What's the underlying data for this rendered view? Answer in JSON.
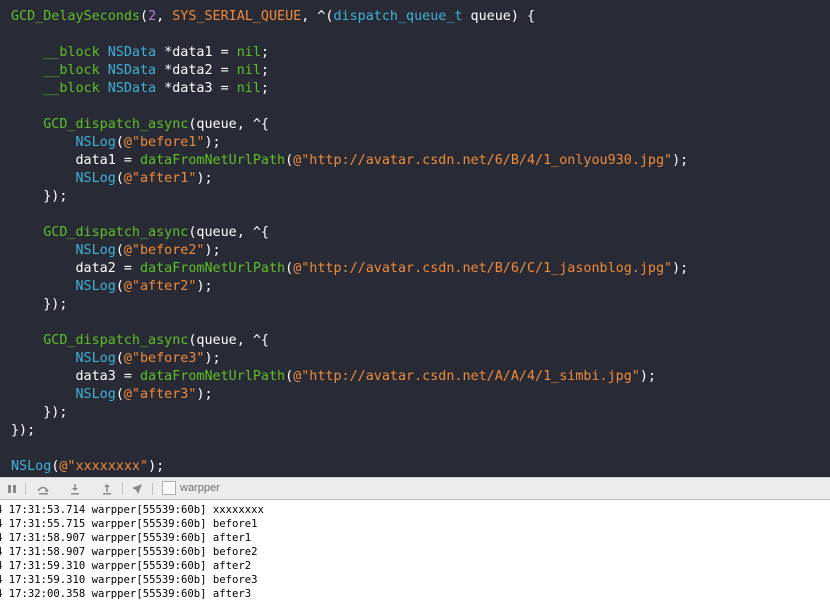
{
  "editor": {
    "lines": [
      [
        {
          "t": "GCD_DelaySeconds",
          "c": "green"
        },
        {
          "t": "(",
          "c": "white"
        },
        {
          "t": "2",
          "c": "purple"
        },
        {
          "t": ", ",
          "c": "white"
        },
        {
          "t": "SYS_SERIAL_QUEUE",
          "c": "orange"
        },
        {
          "t": ", ^(",
          "c": "white"
        },
        {
          "t": "dispatch_queue_t",
          "c": "blue"
        },
        {
          "t": " queue) {",
          "c": "white"
        }
      ],
      [],
      [
        {
          "t": "    ",
          "c": "white"
        },
        {
          "t": "__block",
          "c": "green"
        },
        {
          "t": " ",
          "c": "white"
        },
        {
          "t": "NSData",
          "c": "blue"
        },
        {
          "t": " *data1 = ",
          "c": "white"
        },
        {
          "t": "nil",
          "c": "green"
        },
        {
          "t": ";",
          "c": "white"
        }
      ],
      [
        {
          "t": "    ",
          "c": "white"
        },
        {
          "t": "__block",
          "c": "green"
        },
        {
          "t": " ",
          "c": "white"
        },
        {
          "t": "NSData",
          "c": "blue"
        },
        {
          "t": " *data2 = ",
          "c": "white"
        },
        {
          "t": "nil",
          "c": "green"
        },
        {
          "t": ";",
          "c": "white"
        }
      ],
      [
        {
          "t": "    ",
          "c": "white"
        },
        {
          "t": "__block",
          "c": "green"
        },
        {
          "t": " ",
          "c": "white"
        },
        {
          "t": "NSData",
          "c": "blue"
        },
        {
          "t": " *data3 = ",
          "c": "white"
        },
        {
          "t": "nil",
          "c": "green"
        },
        {
          "t": ";",
          "c": "white"
        }
      ],
      [],
      [
        {
          "t": "    ",
          "c": "white"
        },
        {
          "t": "GCD_dispatch_async",
          "c": "green"
        },
        {
          "t": "(queue, ^{",
          "c": "white"
        }
      ],
      [
        {
          "t": "        ",
          "c": "white"
        },
        {
          "t": "NSLog",
          "c": "blue"
        },
        {
          "t": "(",
          "c": "white"
        },
        {
          "t": "@\"before1\"",
          "c": "orange"
        },
        {
          "t": ");",
          "c": "white"
        }
      ],
      [
        {
          "t": "        data1 = ",
          "c": "white"
        },
        {
          "t": "dataFromNetUrlPath",
          "c": "green"
        },
        {
          "t": "(",
          "c": "white"
        },
        {
          "t": "@\"http://avatar.csdn.net/6/B/4/1_onlyou930.jpg\"",
          "c": "orange"
        },
        {
          "t": ");",
          "c": "white"
        }
      ],
      [
        {
          "t": "        ",
          "c": "white"
        },
        {
          "t": "NSLog",
          "c": "blue"
        },
        {
          "t": "(",
          "c": "white"
        },
        {
          "t": "@\"after1\"",
          "c": "orange"
        },
        {
          "t": ");",
          "c": "white"
        }
      ],
      [
        {
          "t": "    });",
          "c": "white"
        }
      ],
      [],
      [
        {
          "t": "    ",
          "c": "white"
        },
        {
          "t": "GCD_dispatch_async",
          "c": "green"
        },
        {
          "t": "(queue, ^{",
          "c": "white"
        }
      ],
      [
        {
          "t": "        ",
          "c": "white"
        },
        {
          "t": "NSLog",
          "c": "blue"
        },
        {
          "t": "(",
          "c": "white"
        },
        {
          "t": "@\"before2\"",
          "c": "orange"
        },
        {
          "t": ");",
          "c": "white"
        }
      ],
      [
        {
          "t": "        data2 = ",
          "c": "white"
        },
        {
          "t": "dataFromNetUrlPath",
          "c": "green"
        },
        {
          "t": "(",
          "c": "white"
        },
        {
          "t": "@\"http://avatar.csdn.net/B/6/C/1_jasonblog.jpg\"",
          "c": "orange"
        },
        {
          "t": ");",
          "c": "white"
        }
      ],
      [
        {
          "t": "        ",
          "c": "white"
        },
        {
          "t": "NSLog",
          "c": "blue"
        },
        {
          "t": "(",
          "c": "white"
        },
        {
          "t": "@\"after2\"",
          "c": "orange"
        },
        {
          "t": ");",
          "c": "white"
        }
      ],
      [
        {
          "t": "    });",
          "c": "white"
        }
      ],
      [],
      [
        {
          "t": "    ",
          "c": "white"
        },
        {
          "t": "GCD_dispatch_async",
          "c": "green"
        },
        {
          "t": "(queue, ^{",
          "c": "white"
        }
      ],
      [
        {
          "t": "        ",
          "c": "white"
        },
        {
          "t": "NSLog",
          "c": "blue"
        },
        {
          "t": "(",
          "c": "white"
        },
        {
          "t": "@\"before3\"",
          "c": "orange"
        },
        {
          "t": ");",
          "c": "white"
        }
      ],
      [
        {
          "t": "        data3 = ",
          "c": "white"
        },
        {
          "t": "dataFromNetUrlPath",
          "c": "green"
        },
        {
          "t": "(",
          "c": "white"
        },
        {
          "t": "@\"http://avatar.csdn.net/A/A/4/1_simbi.jpg\"",
          "c": "orange"
        },
        {
          "t": ");",
          "c": "white"
        }
      ],
      [
        {
          "t": "        ",
          "c": "white"
        },
        {
          "t": "NSLog",
          "c": "blue"
        },
        {
          "t": "(",
          "c": "white"
        },
        {
          "t": "@\"after3\"",
          "c": "orange"
        },
        {
          "t": ");",
          "c": "white"
        }
      ],
      [
        {
          "t": "    });",
          "c": "white"
        }
      ],
      [
        {
          "t": "});",
          "c": "white"
        }
      ],
      [],
      [
        {
          "t": "NSLog",
          "c": "blue"
        },
        {
          "t": "(",
          "c": "white"
        },
        {
          "t": "@\"xxxxxxxx\"",
          "c": "orange"
        },
        {
          "t": ");",
          "c": "white"
        }
      ]
    ]
  },
  "debugbar": {
    "buttons": [
      "pause-icon",
      "step-over-icon",
      "step-into-icon",
      "step-out-icon",
      "location-arrow-icon"
    ],
    "frame_label": "warpper"
  },
  "console": {
    "lines": [
      "4 17:31:53.714 warpper[55539:60b] xxxxxxxx",
      "4 17:31:55.715 warpper[55539:60b] before1",
      "4 17:31:58.907 warpper[55539:60b] after1",
      "4 17:31:58.907 warpper[55539:60b] before2",
      "4 17:31:59.310 warpper[55539:60b] after2",
      "4 17:31:59.310 warpper[55539:60b] before3",
      "4 17:32:00.358 warpper[55539:60b] after3"
    ]
  },
  "colors": {
    "editor_bg": "#282b35",
    "keyword_green": "#5fbf28",
    "type_blue": "#3eb2d9",
    "string_orange": "#f08a3a",
    "number_purple": "#b77ae0"
  }
}
